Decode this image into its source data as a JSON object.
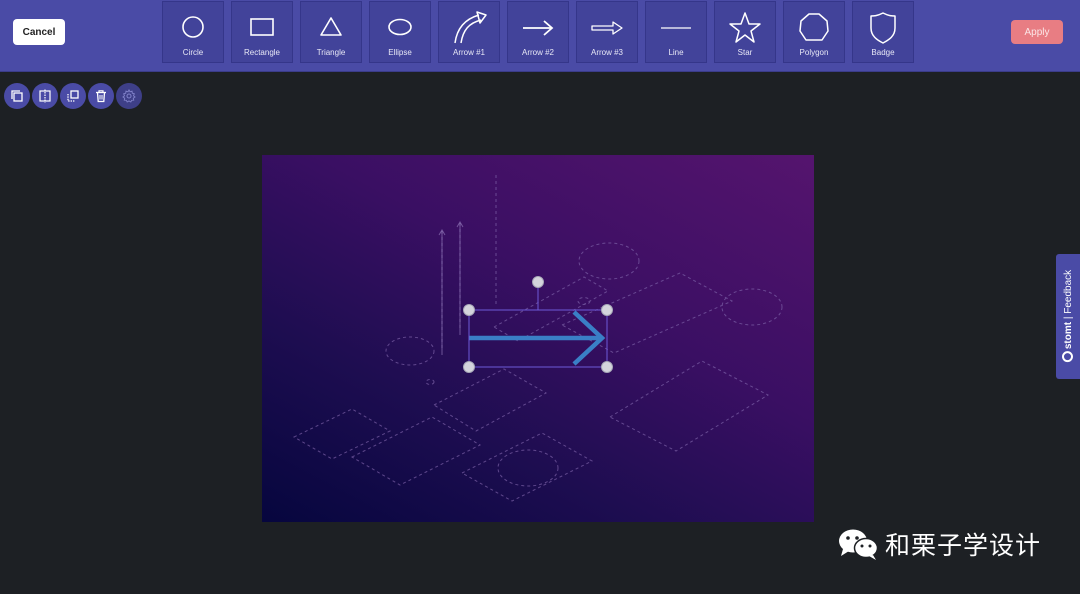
{
  "toolbar": {
    "cancel_label": "Cancel",
    "apply_label": "Apply",
    "tools": [
      {
        "label": "Circle",
        "icon": "circle-icon"
      },
      {
        "label": "Rectangle",
        "icon": "rectangle-icon"
      },
      {
        "label": "Triangle",
        "icon": "triangle-icon"
      },
      {
        "label": "Ellipse",
        "icon": "ellipse-icon"
      },
      {
        "label": "Arrow #1",
        "icon": "curved-arrow-icon"
      },
      {
        "label": "Arrow #2",
        "icon": "arrow-icon"
      },
      {
        "label": "Arrow #3",
        "icon": "hollow-arrow-icon"
      },
      {
        "label": "Line",
        "icon": "line-icon"
      },
      {
        "label": "Star",
        "icon": "star-icon"
      },
      {
        "label": "Polygon",
        "icon": "polygon-icon"
      },
      {
        "label": "Badge",
        "icon": "badge-icon"
      }
    ]
  },
  "object_actions": [
    "duplicate-icon",
    "flip-icon",
    "bring-to-front-icon",
    "trash-icon",
    "settings-icon"
  ],
  "canvas": {
    "selected_shape": "Arrow #2",
    "arrow_color": "#3a7fc6",
    "background_colors": [
      "#06063e",
      "#55146e"
    ]
  },
  "feedback": {
    "brand": "stomt",
    "separator": " | ",
    "label": "Feedback"
  },
  "watermark": {
    "text": "和栗子学设计",
    "icon": "wechat-icon"
  },
  "colors": {
    "toolbar_bg": "#4a4ba6",
    "apply_bg": "#e87d83",
    "app_bg": "#1d2024"
  }
}
